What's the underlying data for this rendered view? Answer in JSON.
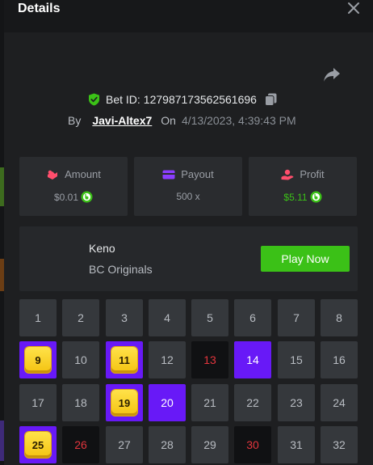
{
  "header": {
    "title": "Details"
  },
  "bet": {
    "id_label": "Bet ID:",
    "id": "127987173562561696",
    "by_label": "By",
    "username": "Javi-Altex7",
    "on_label": "On",
    "datetime": "4/13/2023, 4:39:43 PM"
  },
  "stats": {
    "amount": {
      "label": "Amount",
      "value": "$0.01"
    },
    "payout": {
      "label": "Payout",
      "value": "500 x"
    },
    "profit": {
      "label": "Profit",
      "value": "$5.11"
    }
  },
  "game": {
    "name": "Keno",
    "provider": "BC Originals",
    "play_label": "Play Now"
  },
  "grid": {
    "cells": [
      {
        "n": "1",
        "s": "normal"
      },
      {
        "n": "2",
        "s": "normal"
      },
      {
        "n": "3",
        "s": "normal"
      },
      {
        "n": "4",
        "s": "normal"
      },
      {
        "n": "5",
        "s": "normal"
      },
      {
        "n": "6",
        "s": "normal"
      },
      {
        "n": "7",
        "s": "normal"
      },
      {
        "n": "8",
        "s": "normal"
      },
      {
        "n": "9",
        "s": "hit"
      },
      {
        "n": "10",
        "s": "normal"
      },
      {
        "n": "11",
        "s": "hit"
      },
      {
        "n": "12",
        "s": "normal"
      },
      {
        "n": "13",
        "s": "miss"
      },
      {
        "n": "14",
        "s": "pick"
      },
      {
        "n": "15",
        "s": "normal"
      },
      {
        "n": "16",
        "s": "normal"
      },
      {
        "n": "17",
        "s": "normal"
      },
      {
        "n": "18",
        "s": "normal"
      },
      {
        "n": "19",
        "s": "hit"
      },
      {
        "n": "20",
        "s": "pick"
      },
      {
        "n": "21",
        "s": "normal"
      },
      {
        "n": "22",
        "s": "normal"
      },
      {
        "n": "23",
        "s": "normal"
      },
      {
        "n": "24",
        "s": "normal"
      },
      {
        "n": "25",
        "s": "hit"
      },
      {
        "n": "26",
        "s": "miss"
      },
      {
        "n": "27",
        "s": "normal"
      },
      {
        "n": "28",
        "s": "normal"
      },
      {
        "n": "29",
        "s": "normal"
      },
      {
        "n": "30",
        "s": "miss"
      },
      {
        "n": "31",
        "s": "normal"
      },
      {
        "n": "32",
        "s": "normal"
      }
    ]
  },
  "colors": {
    "accent_green": "#3bc117",
    "pick_purple": "#6819f7",
    "miss_red": "#e2353d",
    "gem_gold": "#f4c311"
  },
  "icons": {
    "close": "close-icon",
    "share": "share-icon",
    "shield": "shield-check-icon",
    "copy": "copy-icon",
    "amount": "coins-icon",
    "payout": "wallet-icon",
    "profit": "hand-coin-icon",
    "coin": "bcd-coin-icon"
  }
}
